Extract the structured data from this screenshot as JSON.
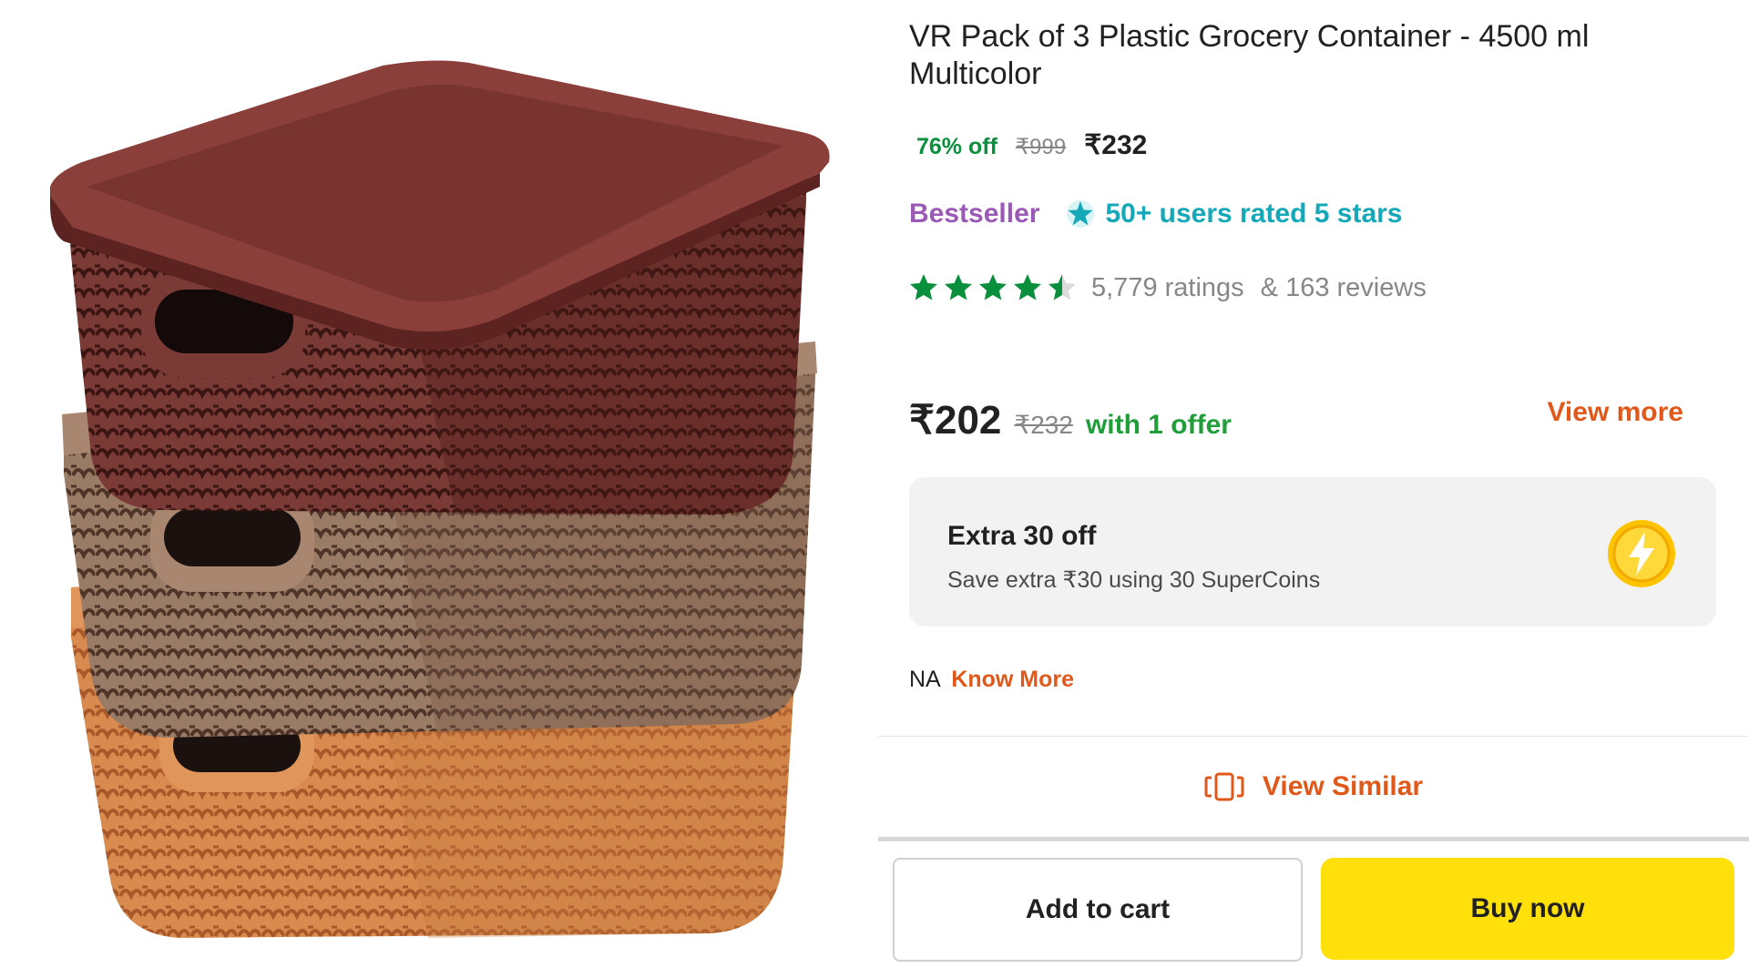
{
  "product": {
    "title": "VR Pack of 3 Plastic Grocery Container  - 4500 ml Multicolor",
    "image_alt": "stack of three woven plastic baskets in brown, taupe and orange"
  },
  "pricing": {
    "discount": "76% off",
    "mrp": "₹999",
    "price": "₹232"
  },
  "badges": {
    "bestseller": "Bestseller",
    "rated_text": "50+ users rated 5 stars"
  },
  "rating": {
    "stars_value": 4.5,
    "ratings_text": "5,779 ratings",
    "reviews_text": "& 163 reviews"
  },
  "offer": {
    "price": "₹202",
    "mrp": "₹232",
    "text": "with 1 offer",
    "view_more": "View more"
  },
  "supercoins": {
    "title": "Extra 30 off",
    "subtitle": "Save extra ₹30 using 30 SuperCoins",
    "icon": "lightning-coin-icon"
  },
  "know": {
    "prefix": "NA",
    "link": "Know More"
  },
  "actions": {
    "view_similar": "View Similar",
    "add_to_cart": "Add to cart",
    "buy_now": "Buy now"
  },
  "colors": {
    "accent_orange": "#e0581a",
    "green": "#1f9e39",
    "bestseller_purple": "#9b59b6",
    "teal": "#14a8b8",
    "buy_yellow": "#ffe00a",
    "star_green": "#0a8f3c"
  }
}
